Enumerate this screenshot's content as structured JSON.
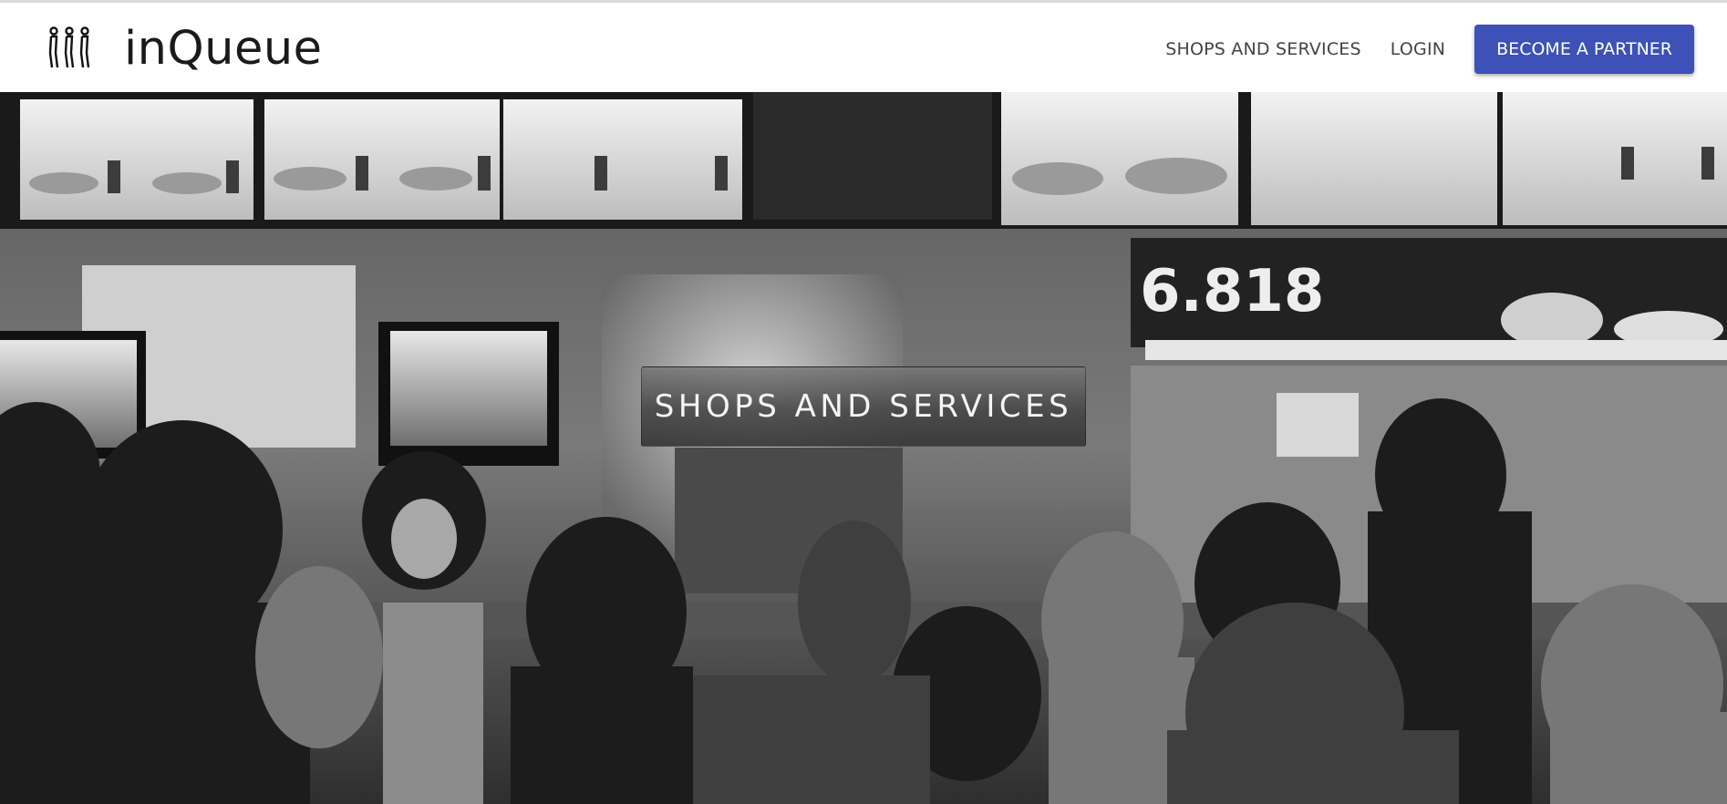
{
  "brand": {
    "name": "inQueue",
    "logo_icon": "queue-people-icon"
  },
  "nav": {
    "links": [
      {
        "label": "SHOPS AND SERVICES"
      },
      {
        "label": "LOGIN"
      }
    ],
    "cta_label": "BECOME A PARTNER"
  },
  "hero": {
    "title": "SHOPS AND SERVICES",
    "image_description_icon": "fast-food-counter-photo"
  },
  "colors": {
    "accent": "#3d51b8",
    "text_dark": "#1a1a1a",
    "nav_text": "#444444"
  }
}
